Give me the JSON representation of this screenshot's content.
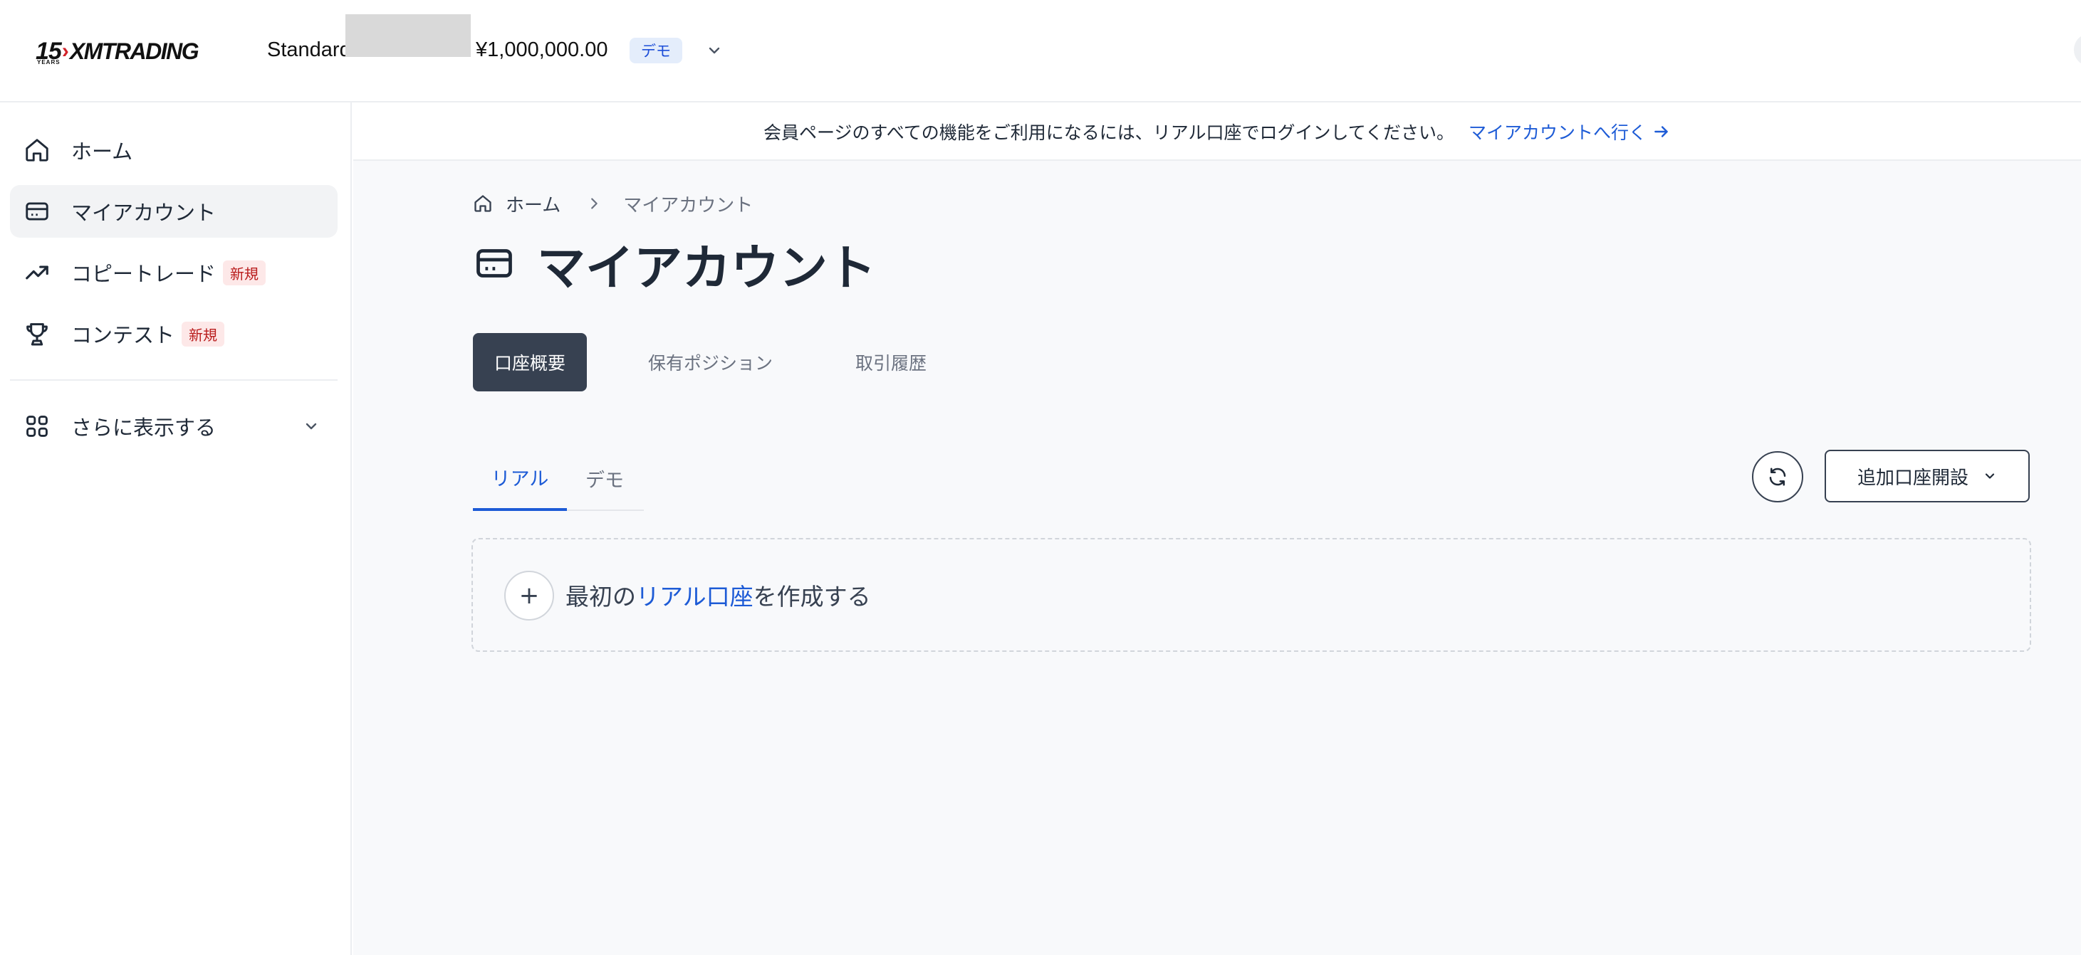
{
  "header": {
    "logo_years": "15",
    "logo_years_sub": "YEARS",
    "logo_brand": "XMTRADING",
    "account_name": "Standard",
    "balance": "¥1,000,000.00",
    "demo_badge": "デモ"
  },
  "sidebar": {
    "items": [
      {
        "label": "ホーム",
        "icon": "home-icon"
      },
      {
        "label": "マイアカウント",
        "icon": "credit-card-icon",
        "active": true
      },
      {
        "label": "コピートレード",
        "icon": "trending-up-icon",
        "badge": "新規"
      },
      {
        "label": "コンテスト",
        "icon": "trophy-icon",
        "badge": "新規"
      }
    ],
    "more_label": "さらに表示する"
  },
  "notice": {
    "text": "会員ページのすべての機能をご利用になるには、リアル口座でログインしてください。",
    "link": "マイアカウントへ行く"
  },
  "breadcrumb": {
    "home": "ホーム",
    "current": "マイアカウント"
  },
  "page": {
    "title": "マイアカウント"
  },
  "tabs": [
    "口座概要",
    "保有ポジション",
    "取引履歴"
  ],
  "sub_tabs": [
    "リアル",
    "デモ"
  ],
  "actions": {
    "add_account": "追加口座開設"
  },
  "create": {
    "prefix": "最初の",
    "highlight": "リアル口座",
    "suffix": "を作成する"
  },
  "colors": {
    "accent": "#1d5bd6",
    "dark": "#374151",
    "badge_bg": "#fde8e8",
    "badge_text": "#b91c1c"
  }
}
